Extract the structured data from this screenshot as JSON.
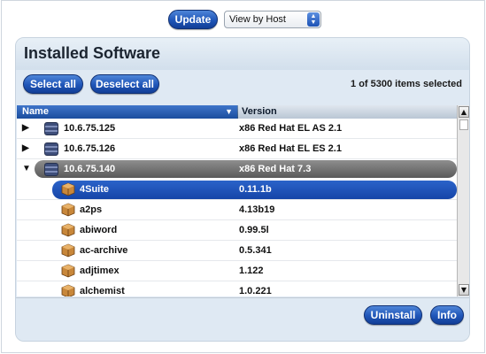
{
  "toolbar": {
    "update_label": "Update",
    "view_select_value": "View by Host"
  },
  "panel": {
    "title": "Installed Software",
    "select_all_label": "Select all",
    "deselect_all_label": "Deselect all",
    "selection_count": "1 of 5300 items selected"
  },
  "table": {
    "col_name": "Name",
    "col_version": "Version",
    "rows": [
      {
        "type": "host",
        "name": "10.6.75.125",
        "version": "x86 Red Hat EL AS 2.1",
        "expanded": false
      },
      {
        "type": "host",
        "name": "10.6.75.126",
        "version": "x86 Red Hat EL ES 2.1",
        "expanded": false
      },
      {
        "type": "host",
        "name": "10.6.75.140",
        "version": "x86 Red Hat 7.3",
        "expanded": true
      },
      {
        "type": "package",
        "name": "4Suite",
        "version": "0.11.1b",
        "selected": true
      },
      {
        "type": "package",
        "name": "a2ps",
        "version": "4.13b19"
      },
      {
        "type": "package",
        "name": "abiword",
        "version": "0.99.5l"
      },
      {
        "type": "package",
        "name": "ac-archive",
        "version": "0.5.341"
      },
      {
        "type": "package",
        "name": "adjtimex",
        "version": "1.122"
      },
      {
        "type": "package",
        "name": "alchemist",
        "version": "1.0.221"
      }
    ]
  },
  "footer": {
    "uninstall_label": "Uninstall",
    "info_label": "Info"
  },
  "icons": {
    "collapsed": "triangle-right-icon",
    "expanded": "triangle-down-icon",
    "host": "server-icon",
    "package": "package-box-icon"
  },
  "colors": {
    "accent_blue": "#1f55b8",
    "panel_bg": "#dfe9f3",
    "expanded_row": "#6e6e6e"
  }
}
